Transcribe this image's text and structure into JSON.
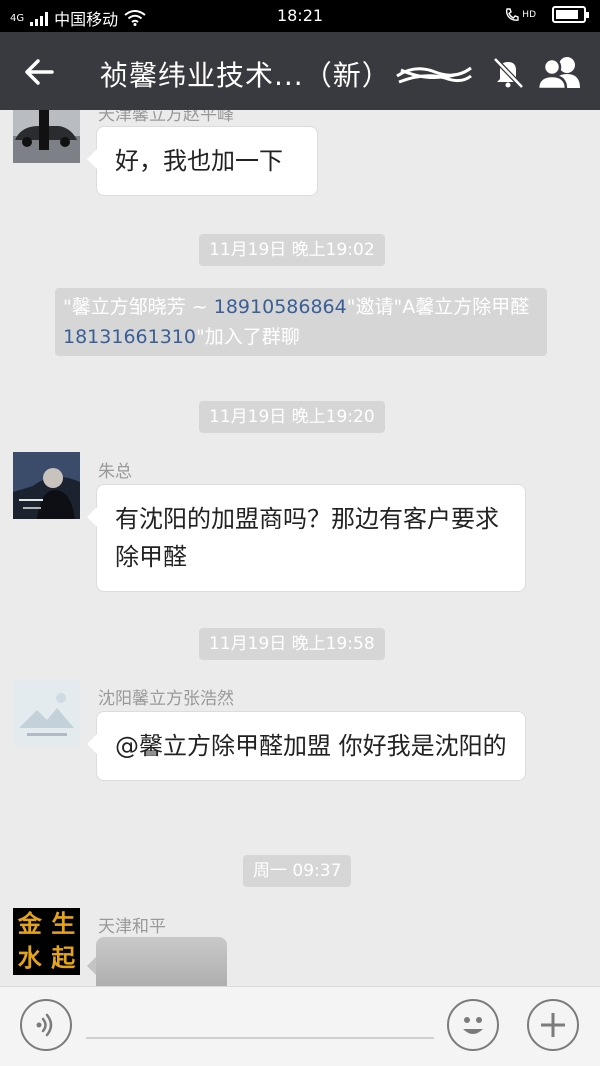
{
  "status_bar": {
    "network": "4G",
    "carrier": "中国移动",
    "time": "18:21",
    "volte": "HD"
  },
  "header": {
    "title": "祯馨纬业技术...（新）",
    "icons": [
      "back-arrow-icon",
      "mute-icon",
      "members-icon"
    ]
  },
  "messages": [
    {
      "sender": "天津馨立方赵平峰",
      "text": "好，我也加一下"
    },
    {
      "timestamp": "11月19日 晚上19:02"
    },
    {
      "system": {
        "part1": "\"馨立方邹晓芳 ~ ",
        "phone1": "18910586864",
        "part2": "\"邀请\"A馨立方除甲醛",
        "phone2": "18131661310",
        "part3": "\"加入了群聊"
      }
    },
    {
      "timestamp": "11月19日 晚上19:20"
    },
    {
      "sender": "朱总",
      "text": "有沈阳的加盟商吗？那边有客户要求除甲醛"
    },
    {
      "timestamp": "11月19日 晚上19:58"
    },
    {
      "sender": "沈阳馨立方张浩然",
      "text": "@馨立方除甲醛加盟 你好我是沈阳的"
    },
    {
      "timestamp": "周一 09:37"
    },
    {
      "sender": "天津和平",
      "avatar_text": [
        "金",
        "生",
        "水",
        "起"
      ]
    }
  ],
  "input_bar": {
    "icons": [
      "voice-icon",
      "emoji-icon",
      "plus-icon"
    ]
  },
  "colors": {
    "header_bg": "#393a3f",
    "chat_bg": "#ebebeb",
    "timestamp_bg": "#d6d6d6",
    "phone_link": "#3a5f97",
    "avatar_gold": "#e3a41b"
  }
}
